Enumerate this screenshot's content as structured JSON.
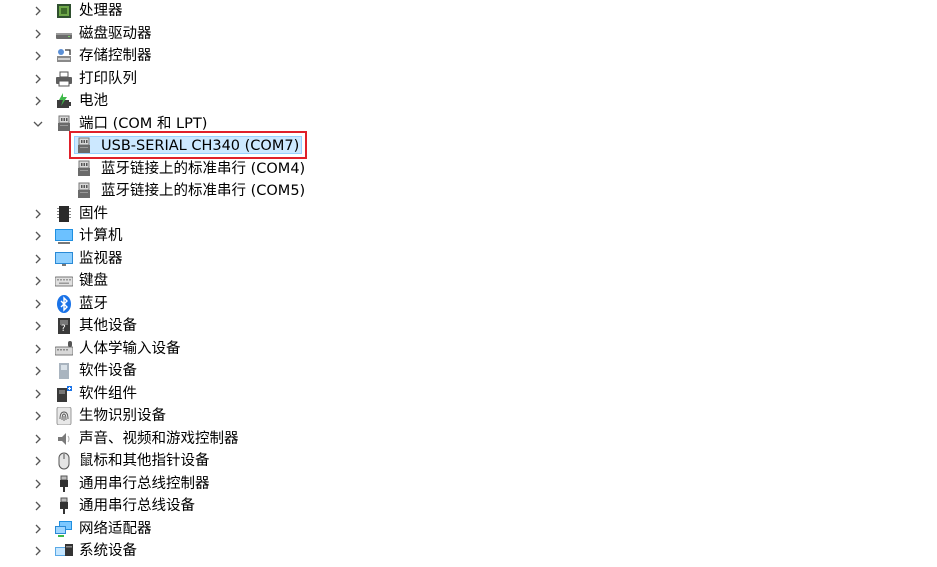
{
  "tree": {
    "categories": [
      {
        "label": "处理器",
        "icon": "cpu-icon",
        "expanded": false
      },
      {
        "label": "磁盘驱动器",
        "icon": "disk-drive-icon",
        "expanded": false
      },
      {
        "label": "存储控制器",
        "icon": "storage-controller-icon",
        "expanded": false
      },
      {
        "label": "打印队列",
        "icon": "printer-icon",
        "expanded": false
      },
      {
        "label": "电池",
        "icon": "battery-icon",
        "expanded": false
      },
      {
        "label": "端口 (COM 和 LPT)",
        "icon": "port-icon",
        "expanded": true,
        "children": [
          {
            "label": "USB-SERIAL CH340 (COM7)",
            "icon": "port-icon",
            "selected": true
          },
          {
            "label": "蓝牙链接上的标准串行 (COM4)",
            "icon": "port-icon",
            "selected": false
          },
          {
            "label": "蓝牙链接上的标准串行 (COM5)",
            "icon": "port-icon",
            "selected": false
          }
        ]
      },
      {
        "label": "固件",
        "icon": "firmware-icon",
        "expanded": false
      },
      {
        "label": "计算机",
        "icon": "computer-icon",
        "expanded": false
      },
      {
        "label": "监视器",
        "icon": "monitor-icon",
        "expanded": false
      },
      {
        "label": "键盘",
        "icon": "keyboard-icon",
        "expanded": false
      },
      {
        "label": "蓝牙",
        "icon": "bluetooth-icon",
        "expanded": false
      },
      {
        "label": "其他设备",
        "icon": "other-device-icon",
        "expanded": false
      },
      {
        "label": "人体学输入设备",
        "icon": "hid-icon",
        "expanded": false
      },
      {
        "label": "软件设备",
        "icon": "software-device-icon",
        "expanded": false
      },
      {
        "label": "软件组件",
        "icon": "software-component-icon",
        "expanded": false
      },
      {
        "label": "生物识别设备",
        "icon": "fingerprint-icon",
        "expanded": false
      },
      {
        "label": "声音、视频和游戏控制器",
        "icon": "speaker-icon",
        "expanded": false
      },
      {
        "label": "鼠标和其他指针设备",
        "icon": "mouse-icon",
        "expanded": false
      },
      {
        "label": "通用串行总线控制器",
        "icon": "usb-icon",
        "expanded": false
      },
      {
        "label": "通用串行总线设备",
        "icon": "usb-icon",
        "expanded": false
      },
      {
        "label": "网络适配器",
        "icon": "network-adapter-icon",
        "expanded": false
      },
      {
        "label": "系统设备",
        "icon": "system-device-icon",
        "expanded": false
      }
    ]
  },
  "colors": {
    "selection_bg": "#cce8ff",
    "selection_border": "#99d1ff",
    "highlight_box": "#e0202a"
  }
}
